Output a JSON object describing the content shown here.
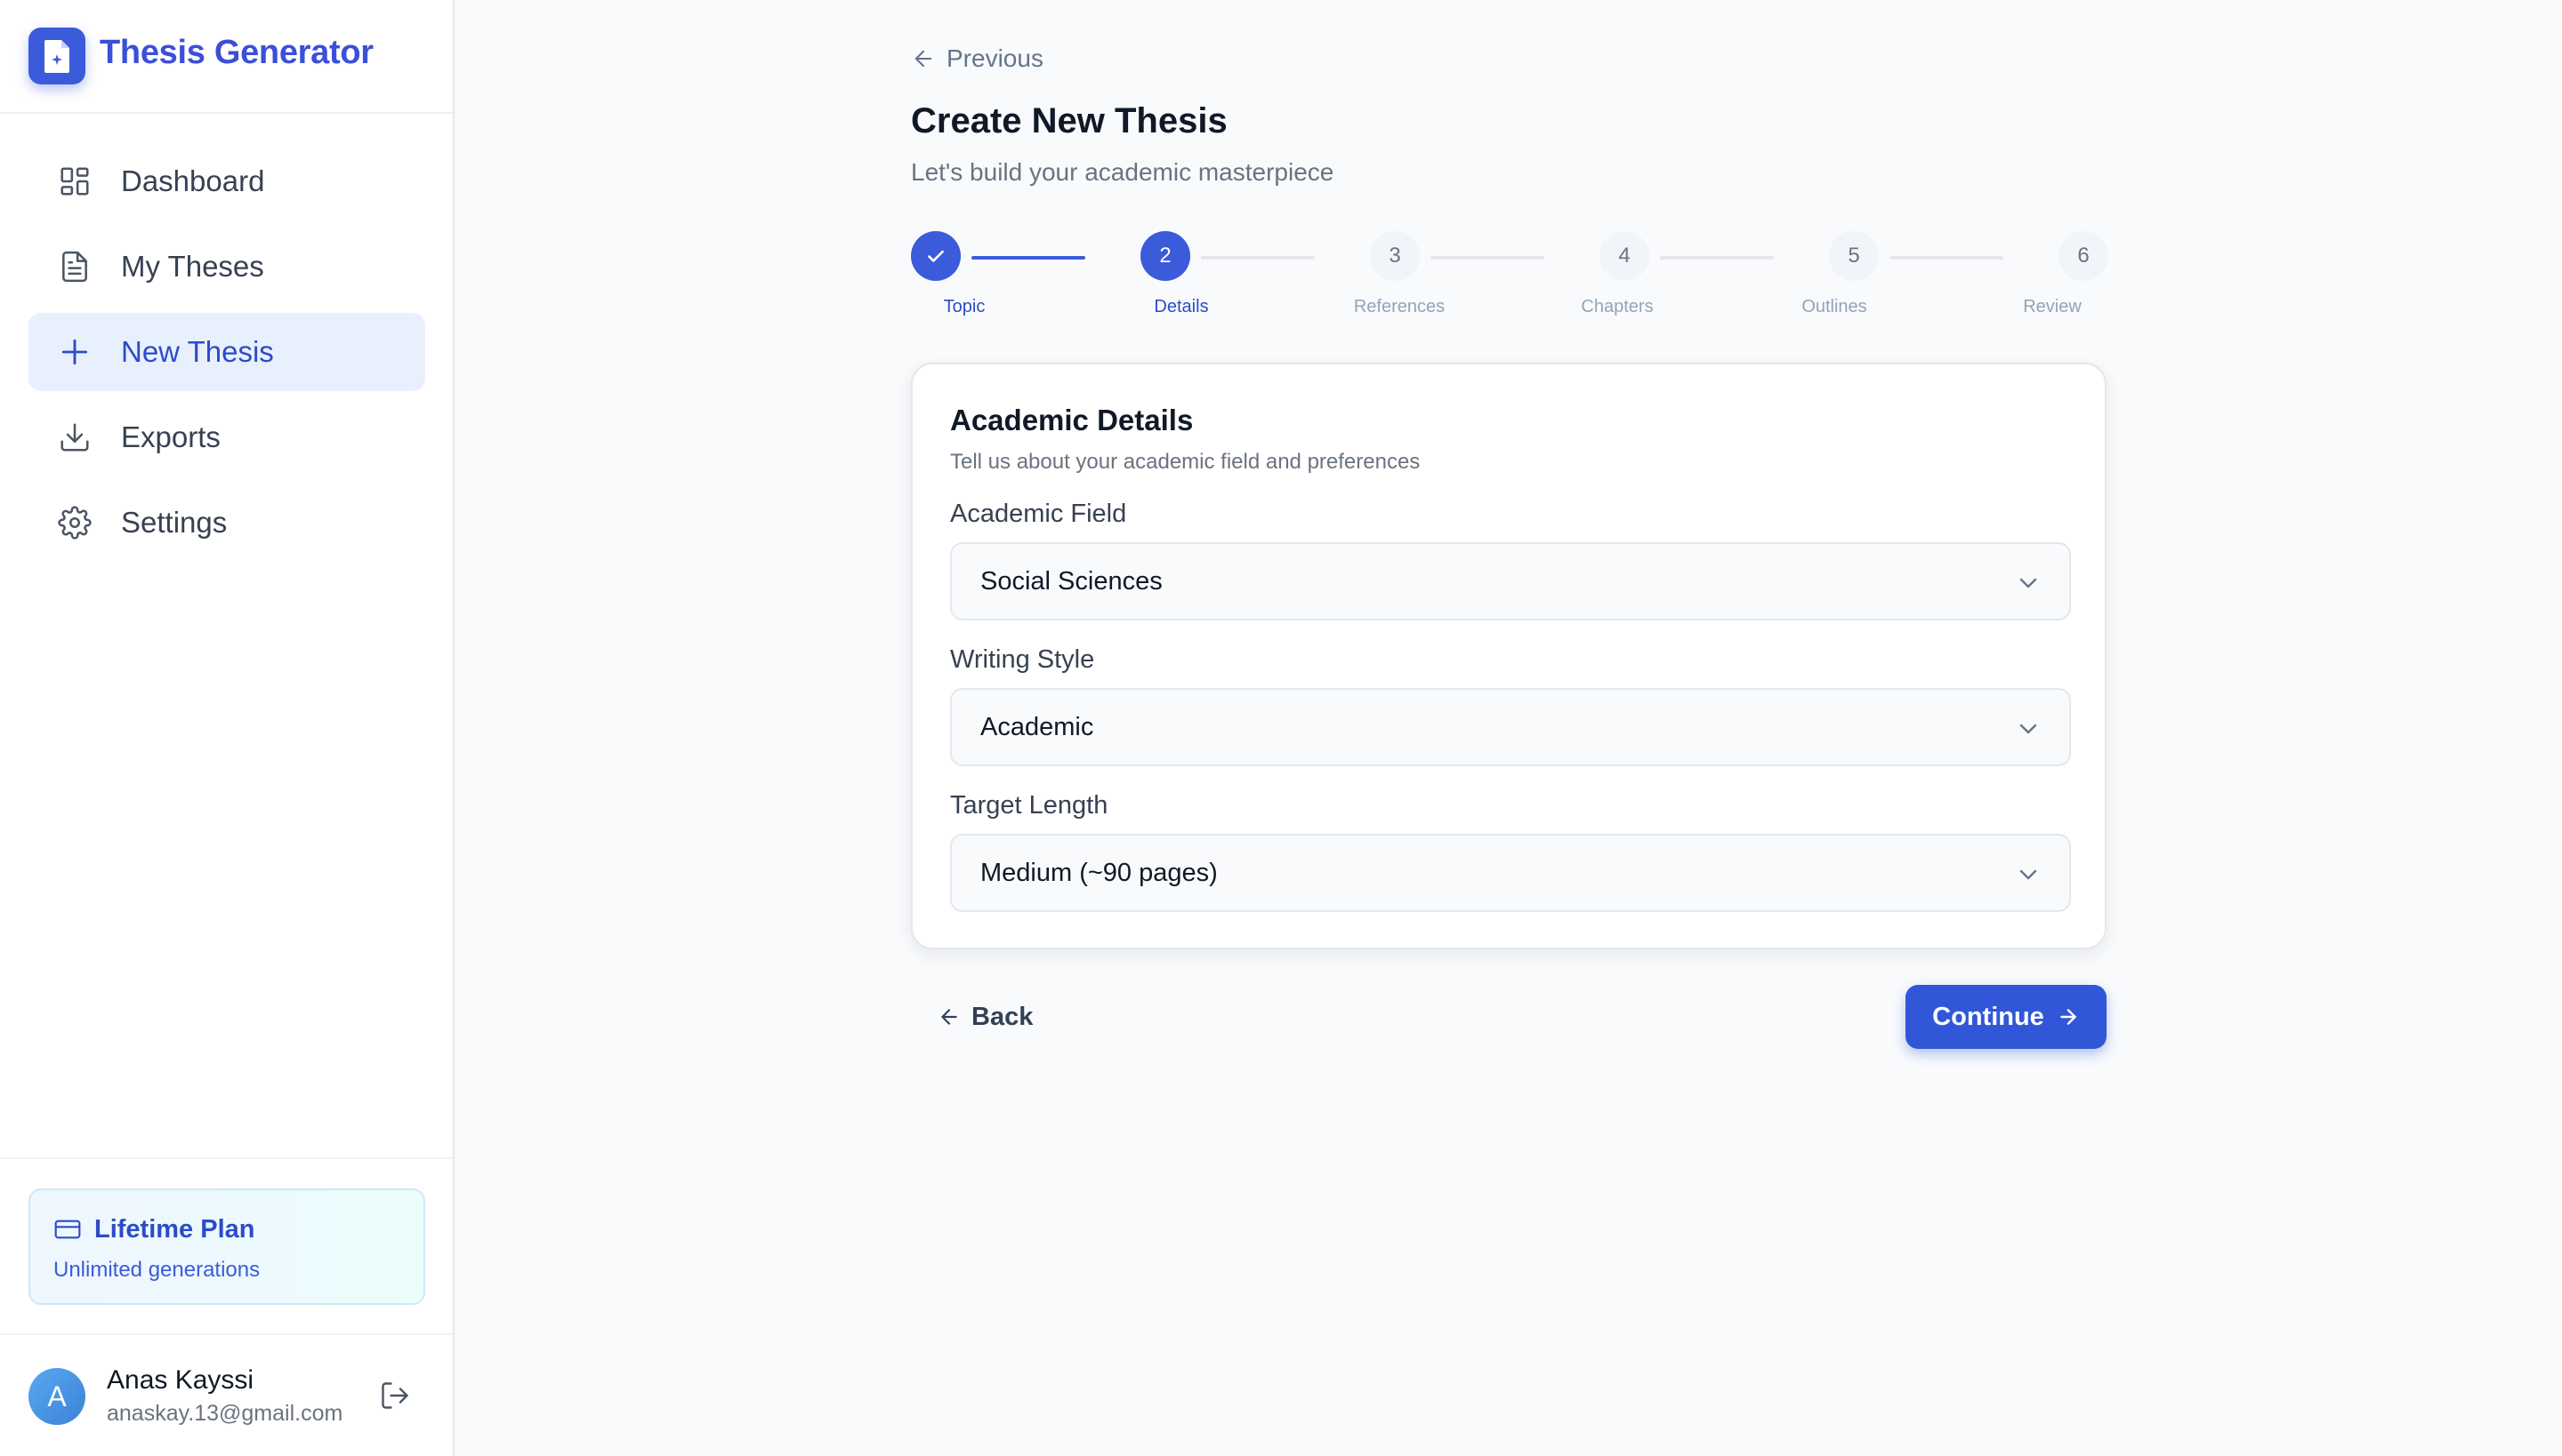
{
  "app": {
    "title": "Thesis Generator"
  },
  "sidebar": {
    "items": [
      {
        "label": "Dashboard",
        "icon": "dashboard-icon"
      },
      {
        "label": "My Theses",
        "icon": "document-icon"
      },
      {
        "label": "New Thesis",
        "icon": "plus-icon",
        "active": true
      },
      {
        "label": "Exports",
        "icon": "download-icon"
      },
      {
        "label": "Settings",
        "icon": "gear-icon"
      }
    ],
    "plan": {
      "title": "Lifetime Plan",
      "subtitle": "Unlimited generations"
    },
    "user": {
      "initial": "A",
      "name": "Anas Kayssi",
      "email": "anaskay.13@gmail.com"
    }
  },
  "main": {
    "previous_label": "Previous",
    "title": "Create New Thesis",
    "subtitle": "Let's build your academic masterpiece",
    "steps": [
      {
        "number": "",
        "label": "Topic",
        "state": "done"
      },
      {
        "number": "2",
        "label": "Details",
        "state": "current"
      },
      {
        "number": "3",
        "label": "References",
        "state": "todo"
      },
      {
        "number": "4",
        "label": "Chapters",
        "state": "todo"
      },
      {
        "number": "5",
        "label": "Outlines",
        "state": "todo"
      },
      {
        "number": "6",
        "label": "Review",
        "state": "todo"
      }
    ],
    "card": {
      "title": "Academic Details",
      "subtitle": "Tell us about your academic field and preferences",
      "fields": [
        {
          "label": "Academic Field",
          "value": "Social Sciences"
        },
        {
          "label": "Writing Style",
          "value": "Academic"
        },
        {
          "label": "Target Length",
          "value": "Medium (~90 pages)"
        }
      ]
    },
    "back_label": "Back",
    "continue_label": "Continue"
  },
  "colors": {
    "accent": "#3b5bdb",
    "active_nav_bg": "#e8f0fe",
    "page_bg": "#f8fafc"
  }
}
